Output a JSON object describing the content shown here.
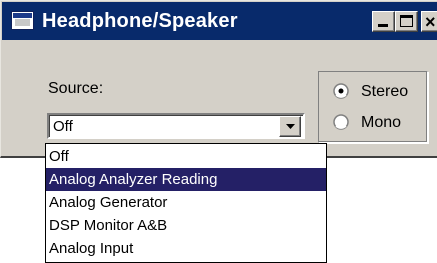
{
  "window": {
    "title": "Headphone/Speaker",
    "controls": {
      "minimize": "minimize",
      "maximize": "maximize",
      "close": "close"
    }
  },
  "source": {
    "label": "Source:",
    "selected_value": "Off",
    "options": [
      {
        "label": "Off",
        "highlighted": false
      },
      {
        "label": "Analog Analyzer Reading",
        "highlighted": true
      },
      {
        "label": "Analog Generator",
        "highlighted": false
      },
      {
        "label": "DSP Monitor A&B",
        "highlighted": false
      },
      {
        "label": "Analog Input",
        "highlighted": false
      }
    ]
  },
  "output_mode": {
    "options": [
      {
        "label": "Stereo",
        "selected": true
      },
      {
        "label": "Mono",
        "selected": false
      }
    ]
  },
  "colors": {
    "titlebar": "#082a6b",
    "face": "#d4d0c8",
    "highlight": "#242066"
  },
  "icons": {
    "app": "window-icon",
    "combo": "chevron-down-icon"
  }
}
